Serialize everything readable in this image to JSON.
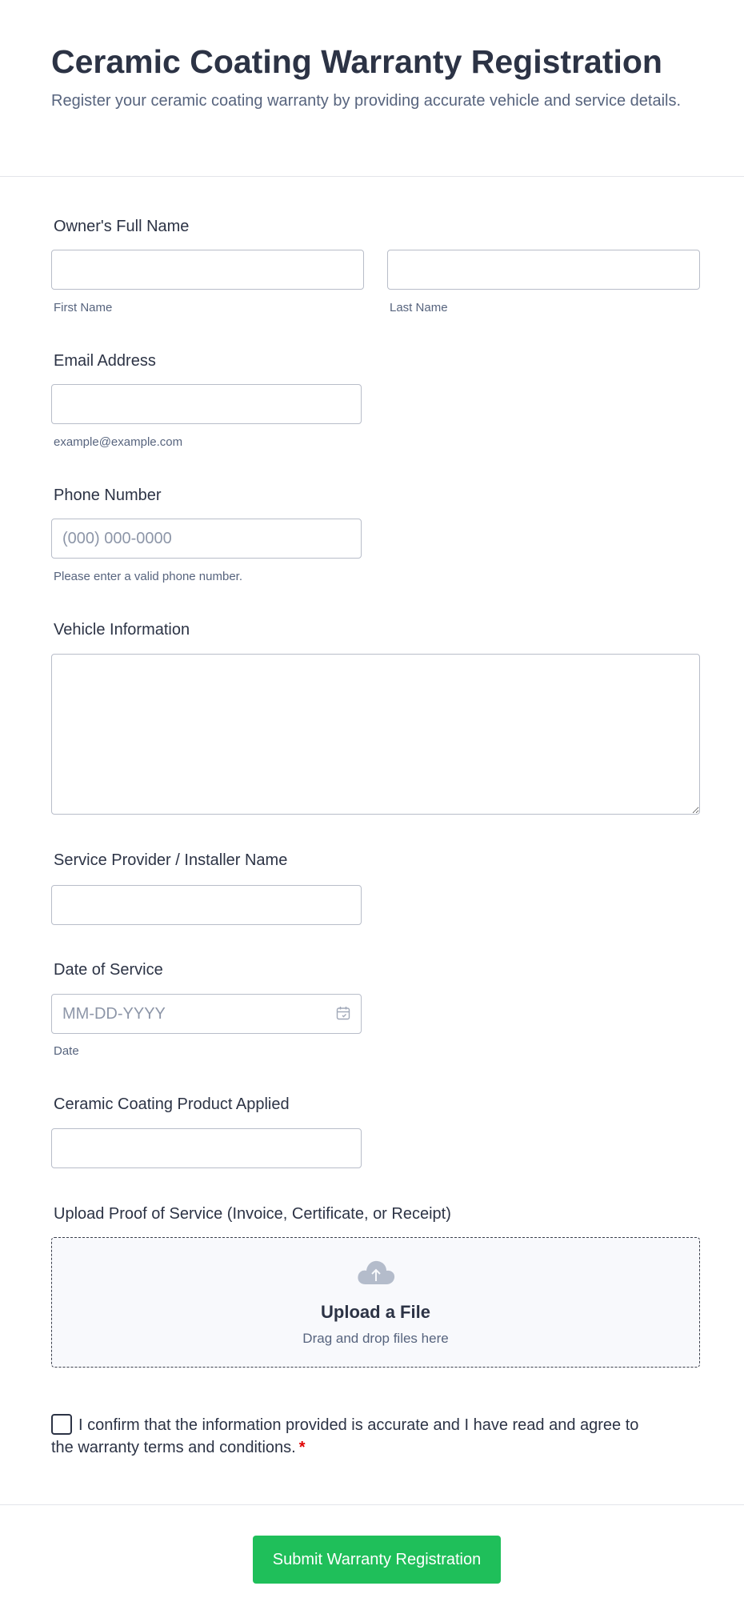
{
  "header": {
    "title": "Ceramic Coating Warranty Registration",
    "subtitle": "Register your ceramic coating warranty by providing accurate vehicle and service details."
  },
  "fields": {
    "owner_name": {
      "label": "Owner's Full Name",
      "first_sublabel": "First Name",
      "last_sublabel": "Last Name",
      "first_value": "",
      "last_value": ""
    },
    "email": {
      "label": "Email Address",
      "value": "",
      "sublabel": "example@example.com"
    },
    "phone": {
      "label": "Phone Number",
      "placeholder": "(000) 000-0000",
      "value": "",
      "sublabel": "Please enter a valid phone number."
    },
    "vehicle": {
      "label": "Vehicle Information",
      "value": ""
    },
    "installer": {
      "label": "Service Provider / Installer Name",
      "value": ""
    },
    "service_date": {
      "label": "Date of Service",
      "placeholder": "MM-DD-YYYY",
      "value": "",
      "sublabel": "Date",
      "icon": "calendar-icon"
    },
    "product": {
      "label": "Ceramic Coating Product Applied",
      "value": ""
    },
    "upload": {
      "label": "Upload Proof of Service (Invoice, Certificate, or Receipt)",
      "title": "Upload a File",
      "subtitle": "Drag and drop files here",
      "icon": "cloud-upload-icon"
    }
  },
  "consent": {
    "text": "I confirm that the information provided is accurate and I have read and agree to the warranty terms and conditions.",
    "required_mark": "*",
    "checked": false
  },
  "submit": {
    "label": "Submit Warranty Registration"
  },
  "colors": {
    "text": "#2c3345",
    "muted": "#57647e",
    "border": "#b8bdc9",
    "submit_bg": "#1fbf5a",
    "required": "#e00000"
  }
}
